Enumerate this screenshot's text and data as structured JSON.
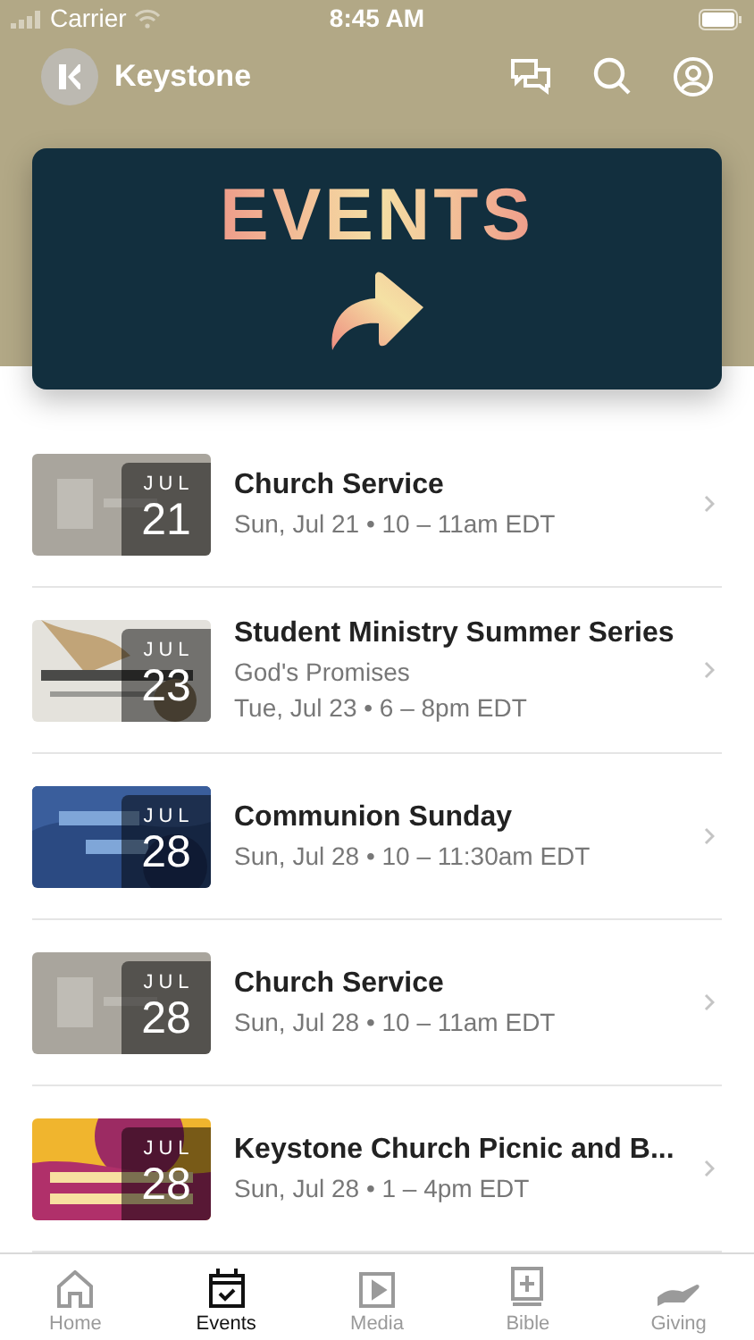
{
  "status_bar": {
    "carrier": "Carrier",
    "time": "8:45 AM"
  },
  "header": {
    "title": "Keystone"
  },
  "banner": {
    "title": "EVENTS"
  },
  "events": [
    {
      "title": "Church Service",
      "month": "JUL",
      "day": "21",
      "lines": [
        "Sun, Jul 21 • 10 – 11am EDT"
      ],
      "thumbnail": {
        "kind": "picture"
      }
    },
    {
      "title": "Student Ministry Summer Series",
      "month": "JUL",
      "day": "23",
      "lines": [
        "God's Promises",
        "Tue, Jul 23 • 6 – 8pm EDT"
      ],
      "thumbnail": {
        "kind": "picture"
      }
    },
    {
      "title": "Communion Sunday",
      "month": "JUL",
      "day": "28",
      "lines": [
        "Sun, Jul 28 • 10 – 11:30am EDT"
      ],
      "thumbnail": {
        "kind": "picture"
      }
    },
    {
      "title": "Church Service",
      "month": "JUL",
      "day": "28",
      "lines": [
        "Sun, Jul 28 • 10 – 11am EDT"
      ],
      "thumbnail": {
        "kind": "picture"
      }
    },
    {
      "title": "Keystone Church Picnic and B...",
      "month": "JUL",
      "day": "28",
      "lines": [
        "Sun, Jul 28 • 1 – 4pm EDT"
      ],
      "thumbnail": {
        "kind": "picture"
      }
    }
  ],
  "tabs": [
    {
      "label": "Home",
      "selected": false
    },
    {
      "label": "Events",
      "selected": true
    },
    {
      "label": "Media",
      "selected": false
    },
    {
      "label": "Bible",
      "selected": false
    },
    {
      "label": "Giving",
      "selected": false
    }
  ]
}
